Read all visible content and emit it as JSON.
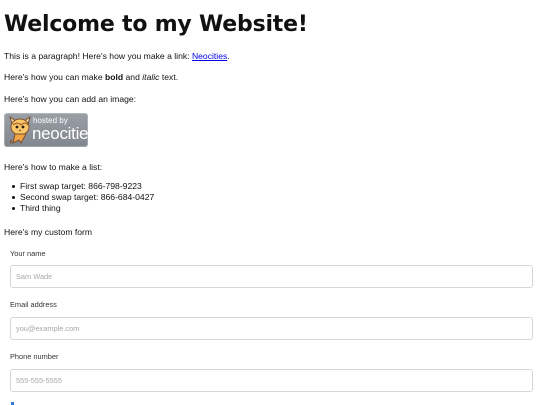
{
  "page": {
    "title": "Welcome to my Website!",
    "intro": {
      "before_link": "This is a paragraph! Here's how you make a link: ",
      "link_text": "Neocities",
      "after_link": "."
    },
    "formatting": {
      "before_bold": "Here's how you can make ",
      "bold_text": "bold",
      "between": " and ",
      "italic_text": "italic",
      "after_italic": " text."
    },
    "image_text": "Here's how you can add an image:",
    "badge": {
      "hosted_by": "hosted by",
      "name": "neocities"
    },
    "list_text": "Here's how to make a list:",
    "list_items": [
      "First swap target: 866-798-9223",
      "Second swap target: 866-684-0427",
      "Third thing"
    ],
    "form_text": "Here's my custom form"
  },
  "form": {
    "name_label": "Your name",
    "name_placeholder": "Sam Wade",
    "email_label": "Email address",
    "email_placeholder": "you@example.com",
    "phone_label": "Phone number",
    "phone_placeholder": "555-555-5555"
  },
  "colors": {
    "link": "#0000ee",
    "input_border": "#d3d7dc",
    "badge_background": "#8b9097"
  }
}
